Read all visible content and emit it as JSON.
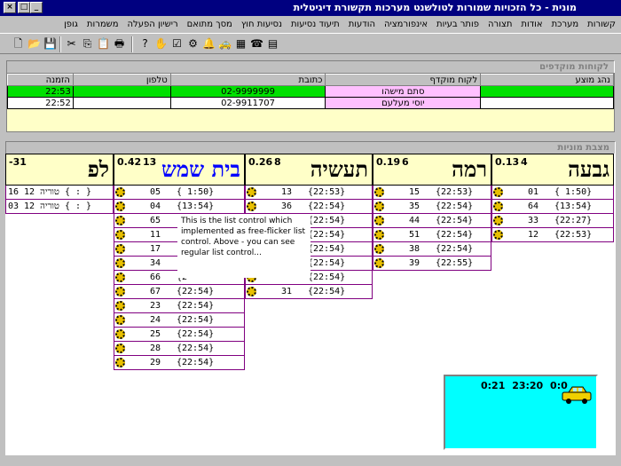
{
  "window": {
    "title": "מונית - כל הזכויות שמורות לטולשנט מערכות תקשורת דיגיטלית",
    "min": "_",
    "max": "□",
    "close": "×"
  },
  "menu": [
    "קשורות",
    "מערכת",
    "אודות",
    "תצורה",
    "פותר בעיות",
    "אינפורמציה",
    "הודעות",
    "תיעוד נסיעות",
    "נסיעות חוץ",
    "מסך מתואם",
    "רישיון הפעלה",
    "משמרות",
    "גופן"
  ],
  "clients_panel": {
    "title": "לקוחות מוקדפים",
    "headers": [
      "הזמנה",
      "טלפון",
      "כתובת",
      "לקוח מוקדף",
      "נהג מוצע"
    ],
    "rows": [
      {
        "time": "22:53",
        "phone": "",
        "address": "02-9999999",
        "client": "סתם מישהו",
        "driver": ""
      },
      {
        "time": "22:52",
        "phone": "",
        "address": "02-9911707",
        "client": "יוסי מעלעם",
        "driver": ""
      }
    ]
  },
  "stations_panel": {
    "title": "מצבת מוניות"
  },
  "stations": [
    {
      "name": "גבעה",
      "avg": "0.13",
      "count": "4",
      "taxis": [
        [
          "01",
          "{ 1:50}"
        ],
        [
          "64",
          "{13:54}"
        ],
        [
          "33",
          "{22:27}"
        ],
        [
          "12",
          "{22:53}"
        ]
      ]
    },
    {
      "name": "רמה",
      "avg": "0.19",
      "count": "6",
      "taxis": [
        [
          "15",
          "{22:53}"
        ],
        [
          "35",
          "{22:54}"
        ],
        [
          "44",
          "{22:54}"
        ],
        [
          "51",
          "{22:54}"
        ],
        [
          "38",
          "{22:54}"
        ],
        [
          "39",
          "{22:55}"
        ]
      ]
    },
    {
      "name": "תעשיה",
      "avg": "0.26",
      "count": "8",
      "taxis": [
        [
          "13",
          "{22:53}"
        ],
        [
          "36",
          "{22:54}"
        ],
        [
          "",
          "{22:54}"
        ],
        [
          "",
          "{22:54}"
        ],
        [
          "",
          "{22:54}"
        ],
        [
          "",
          "{22:54}"
        ],
        [
          "",
          "{22:54}"
        ],
        [
          "31",
          "{22:54}"
        ]
      ]
    },
    {
      "name": "בית שמש",
      "avg": "0.42",
      "count": "13",
      "taxis": [
        [
          "05",
          "{ 1:50}"
        ],
        [
          "04",
          "{13:54}"
        ],
        [
          "65",
          "{1"
        ],
        [
          "11",
          "{2"
        ],
        [
          "17",
          "{2"
        ],
        [
          "34",
          "{2"
        ],
        [
          "66",
          "{2"
        ],
        [
          "67",
          "{22:54}"
        ],
        [
          "23",
          "{22:54}"
        ],
        [
          "24",
          "{22:54}"
        ],
        [
          "25",
          "{22:54}"
        ],
        [
          "28",
          "{22:54}"
        ],
        [
          "29",
          "{22:54}"
        ]
      ]
    },
    {
      "name": "לפ",
      "avg": "-31",
      "count": "",
      "taxis": [
        [
          "16",
          "{ : } טוריה 12"
        ],
        [
          "03",
          "{ : } טוריה 12"
        ]
      ]
    }
  ],
  "tooltip": "This is the list control which implemented as free-flicker list control. Above - you can see regular list control...",
  "clock": {
    "text": "0:21  23:20  0:0"
  },
  "colors": {
    "selected_row": "#00e000",
    "client_cell": "#ffc0ff",
    "panel_bg": "#ffffc8",
    "cyan": "#00ffff"
  }
}
